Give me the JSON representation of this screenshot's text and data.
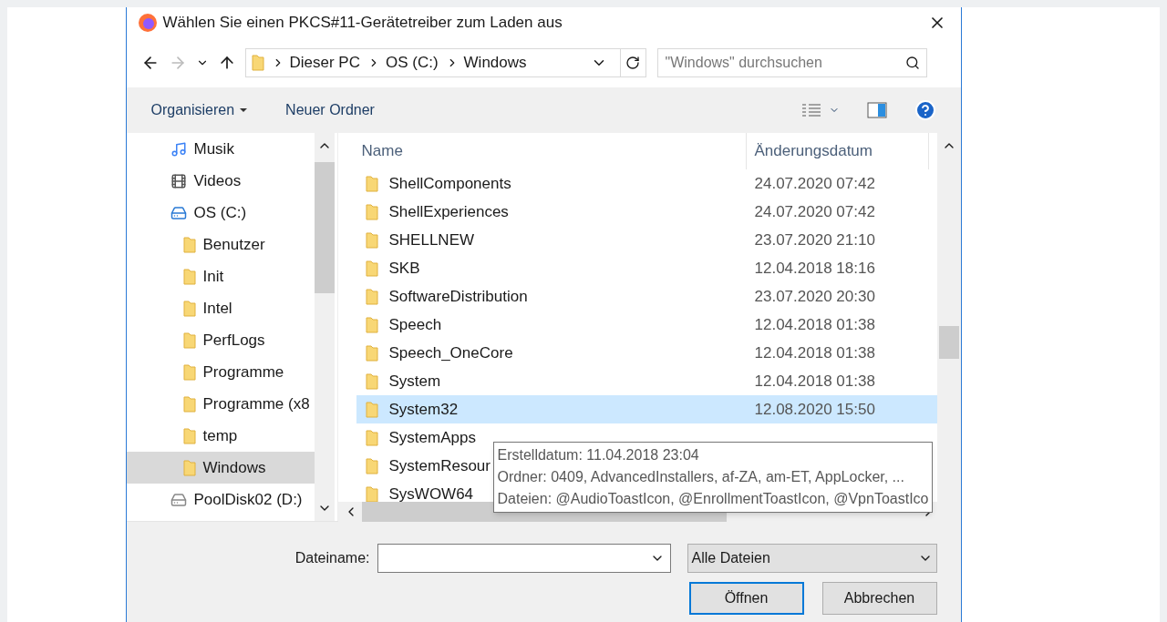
{
  "window": {
    "title": "Wählen Sie einen PKCS#11-Gerätetreiber zum Laden aus"
  },
  "address": {
    "crumbs": [
      "Dieser PC",
      "OS (C:)",
      "Windows"
    ],
    "search_placeholder": "\"Windows\" durchsuchen"
  },
  "toolbar": {
    "organize": "Organisieren",
    "new_folder": "Neuer Ordner"
  },
  "sidebar": {
    "items": [
      {
        "label": "Musik",
        "kind": "music",
        "selected": false
      },
      {
        "label": "Videos",
        "kind": "video",
        "selected": false
      },
      {
        "label": "OS (C:)",
        "kind": "drive",
        "selected": false,
        "children": [
          {
            "label": "Benutzer",
            "kind": "folder",
            "selected": false
          },
          {
            "label": "Init",
            "kind": "folder",
            "selected": false
          },
          {
            "label": "Intel",
            "kind": "folder",
            "selected": false
          },
          {
            "label": "PerfLogs",
            "kind": "folder",
            "selected": false
          },
          {
            "label": "Programme",
            "kind": "folder",
            "selected": false
          },
          {
            "label": "Programme (x8",
            "kind": "folder",
            "selected": false
          },
          {
            "label": "temp",
            "kind": "folder",
            "selected": false
          },
          {
            "label": "Windows",
            "kind": "folder",
            "selected": true
          }
        ]
      },
      {
        "label": "PoolDisk02 (D:)",
        "kind": "disk",
        "selected": false
      }
    ]
  },
  "table": {
    "columns": [
      "Name",
      "Änderungsdatum"
    ],
    "rows": [
      {
        "name": "ShellComponents",
        "date": "24.07.2020 07:42",
        "selected": false
      },
      {
        "name": "ShellExperiences",
        "date": "24.07.2020 07:42",
        "selected": false
      },
      {
        "name": "SHELLNEW",
        "date": "23.07.2020 21:10",
        "selected": false
      },
      {
        "name": "SKB",
        "date": "12.04.2018 18:16",
        "selected": false
      },
      {
        "name": "SoftwareDistribution",
        "date": "23.07.2020 20:30",
        "selected": false
      },
      {
        "name": "Speech",
        "date": "12.04.2018 01:38",
        "selected": false
      },
      {
        "name": "Speech_OneCore",
        "date": "12.04.2018 01:38",
        "selected": false
      },
      {
        "name": "System",
        "date": "12.04.2018 01:38",
        "selected": false
      },
      {
        "name": "System32",
        "date": "12.08.2020 15:50",
        "selected": true
      },
      {
        "name": "SystemApps",
        "selected": false
      },
      {
        "name": "SystemResour",
        "selected": false
      },
      {
        "name": "SysWOW64",
        "selected": false
      }
    ]
  },
  "tooltip": [
    "Erstelldatum: 11.04.2018 23:04",
    "Ordner: 0409, AdvancedInstallers, af-ZA, am-ET, AppLocker, ...",
    "Dateien: @AudioToastIcon, @EnrollmentToastIcon, @VpnToastIco"
  ],
  "footer": {
    "filename_label": "Dateiname:",
    "filter": "Alle Dateien",
    "open": "Öffnen",
    "cancel": "Abbrechen"
  }
}
